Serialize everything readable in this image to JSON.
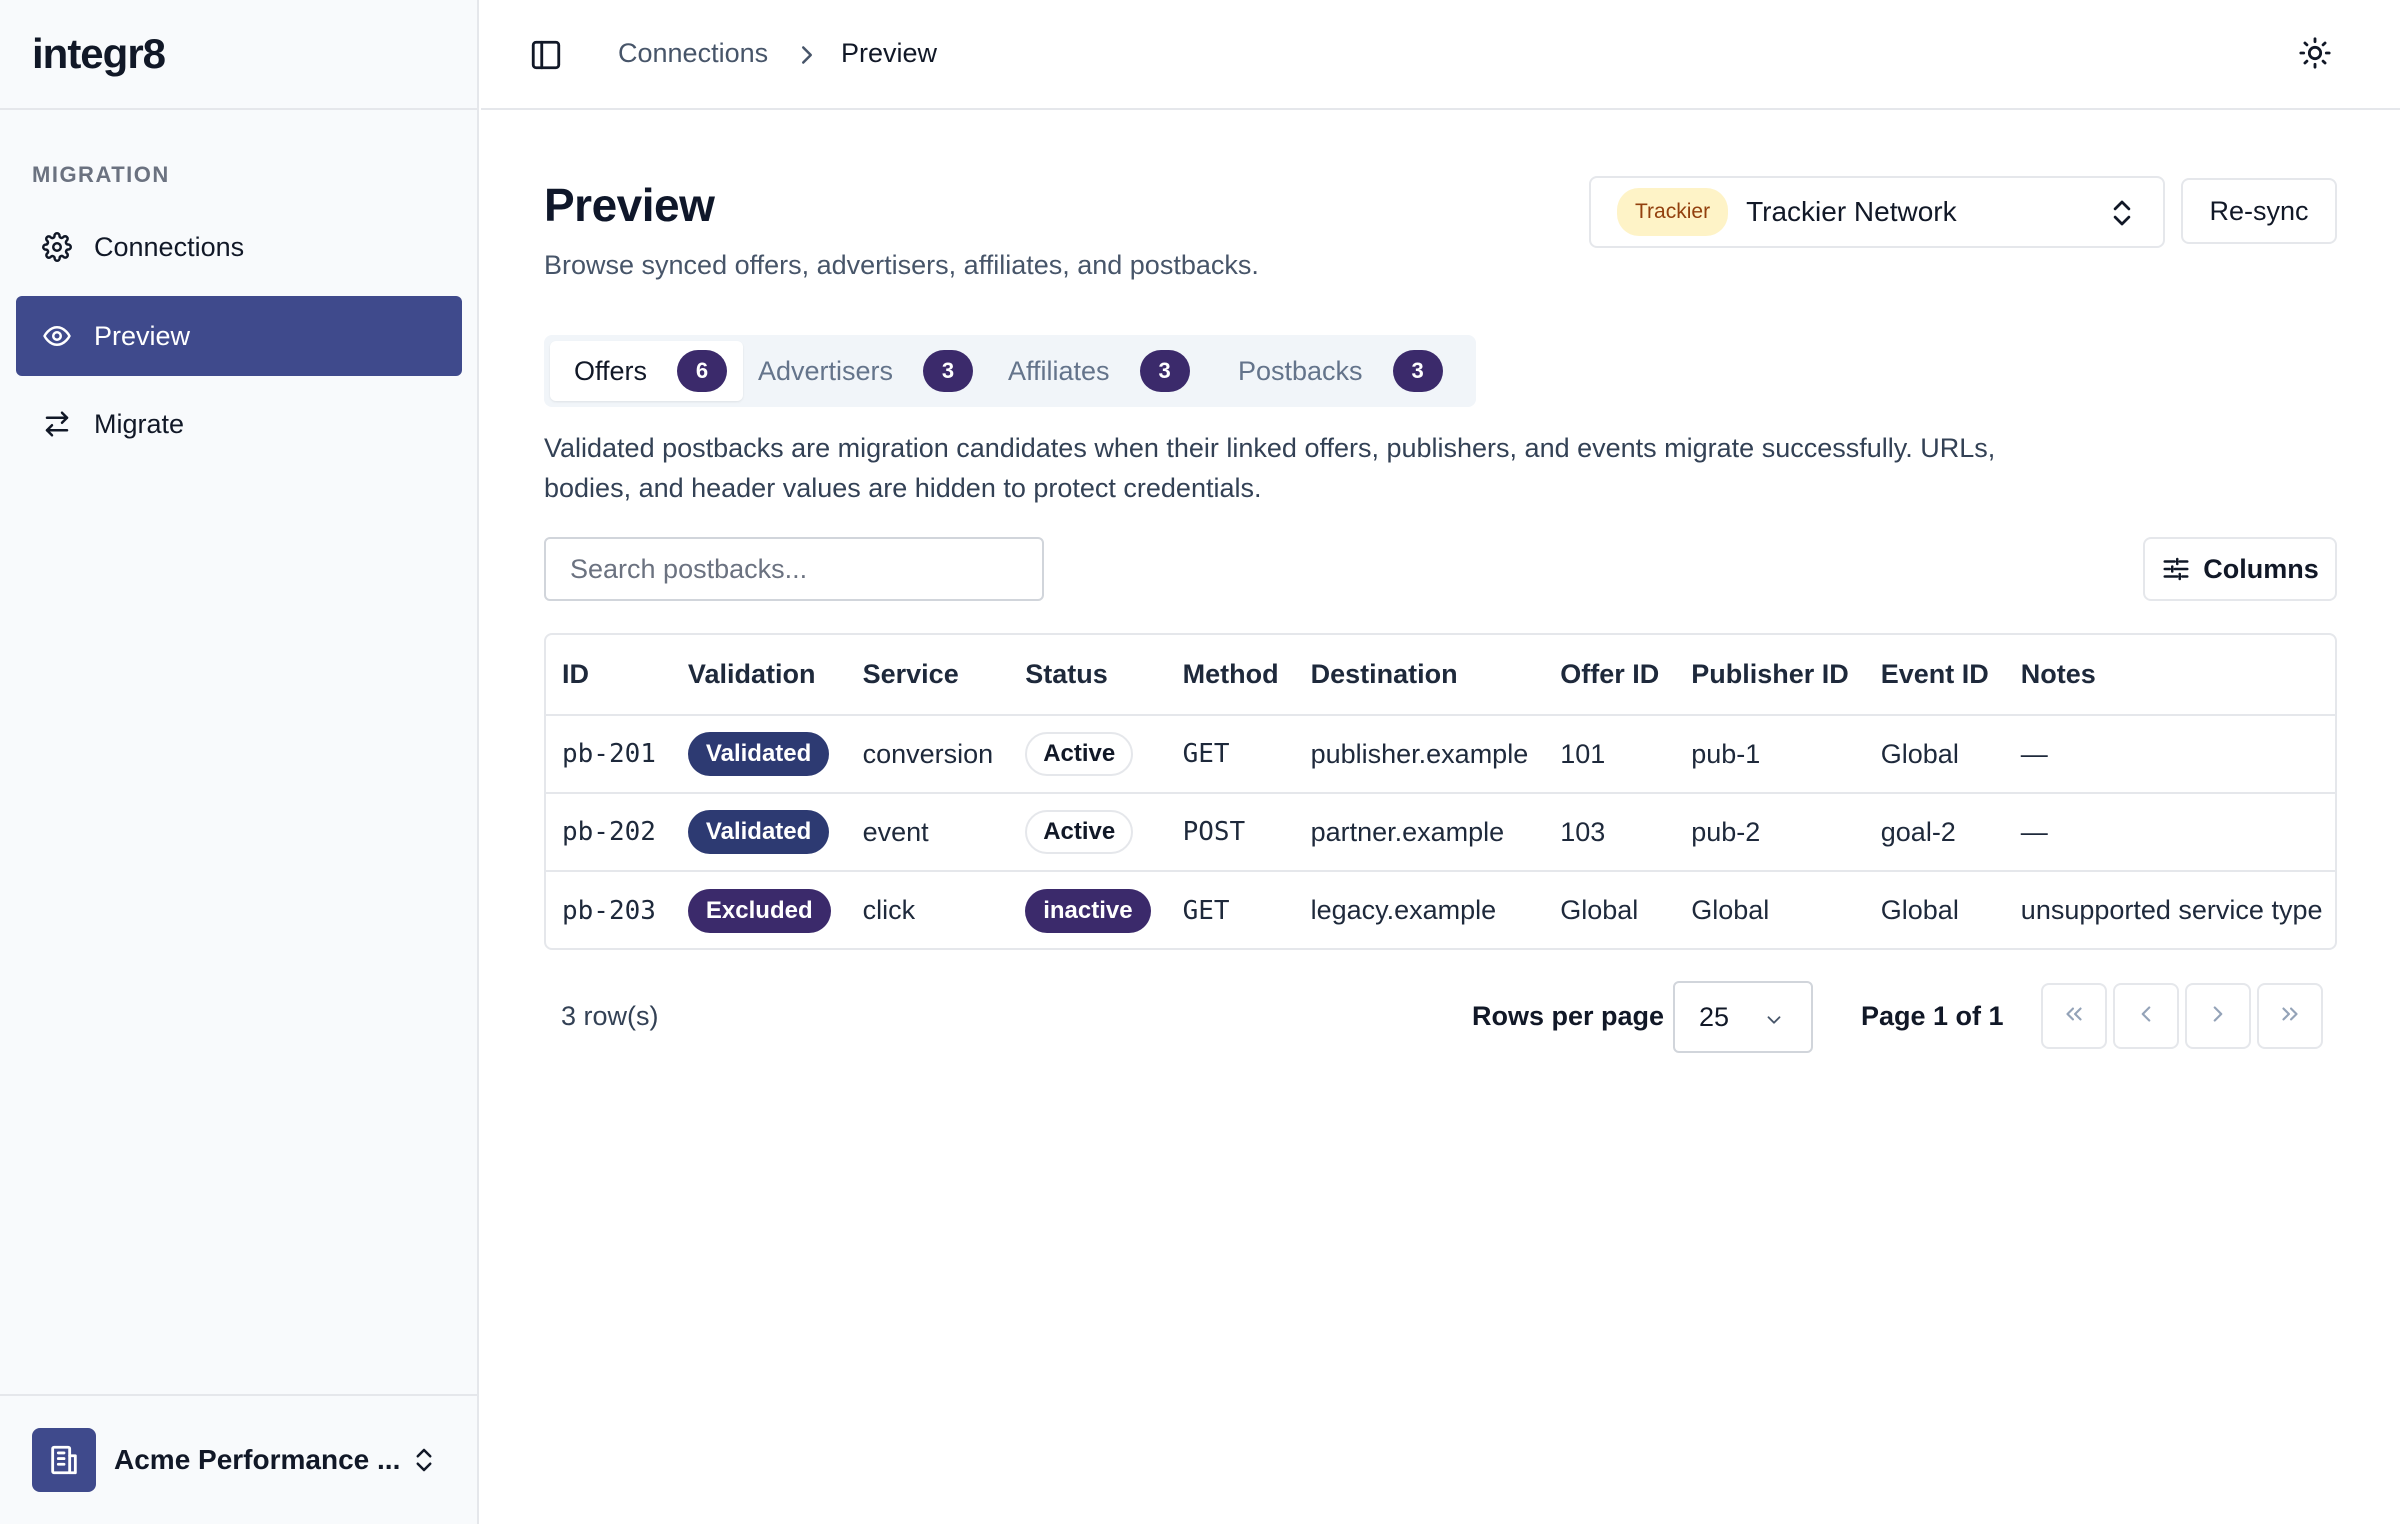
{
  "app": {
    "brand": "integr8"
  },
  "sidebar": {
    "section_label": "MIGRATION",
    "items": [
      {
        "label": "Connections",
        "icon": "gear-icon",
        "active": false
      },
      {
        "label": "Preview",
        "icon": "eye-icon",
        "active": true
      },
      {
        "label": "Migrate",
        "icon": "arrows-swap-icon",
        "active": false
      }
    ],
    "org": {
      "name": "Acme Performance ...",
      "icon": "building-icon"
    }
  },
  "header": {
    "breadcrumb": [
      "Connections",
      "Preview"
    ]
  },
  "main": {
    "title": "Preview",
    "subtitle": "Browse synced offers, advertisers, affiliates, and postbacks.",
    "connection": {
      "provider_badge": "Trackier",
      "name": "Trackier Network"
    },
    "resync_label": "Re-sync",
    "tabs": [
      {
        "label": "Offers",
        "count": "6",
        "active": true
      },
      {
        "label": "Advertisers",
        "count": "3",
        "active": false
      },
      {
        "label": "Affiliates",
        "count": "3",
        "active": false
      },
      {
        "label": "Postbacks",
        "count": "3",
        "active": false
      }
    ],
    "note": "Validated postbacks are migration candidates when their linked offers, publishers, and events migrate successfully. URLs, bodies, and header values are hidden to protect credentials.",
    "search": {
      "placeholder": "Search postbacks...",
      "value": ""
    },
    "columns_label": "Columns",
    "table": {
      "headers": [
        "ID",
        "Validation",
        "Service",
        "Status",
        "Method",
        "Destination",
        "Offer ID",
        "Publisher ID",
        "Event ID",
        "Notes"
      ],
      "rows": [
        {
          "id": "pb-201",
          "validation": "Validated",
          "service": "conversion",
          "status": "Active",
          "method": "GET",
          "destination": "publisher.example",
          "offer_id": "101",
          "publisher_id": "pub-1",
          "event_id": "Global",
          "notes": "—"
        },
        {
          "id": "pb-202",
          "validation": "Validated",
          "service": "event",
          "status": "Active",
          "method": "POST",
          "destination": "partner.example",
          "offer_id": "103",
          "publisher_id": "pub-2",
          "event_id": "goal-2",
          "notes": "—"
        },
        {
          "id": "pb-203",
          "validation": "Excluded",
          "service": "click",
          "status": "inactive",
          "method": "GET",
          "destination": "legacy.example",
          "offer_id": "Global",
          "publisher_id": "Global",
          "event_id": "Global",
          "notes": "unsupported service type"
        }
      ]
    },
    "pagination": {
      "row_count": "3 row(s)",
      "rows_per_page_label": "Rows per page",
      "rows_per_page": "25",
      "page_label": "Page 1 of 1"
    }
  },
  "colors": {
    "accent": "#3f4a8c",
    "badge_dark": "#3b2a6b",
    "provider_badge_bg": "#fef3c7"
  }
}
